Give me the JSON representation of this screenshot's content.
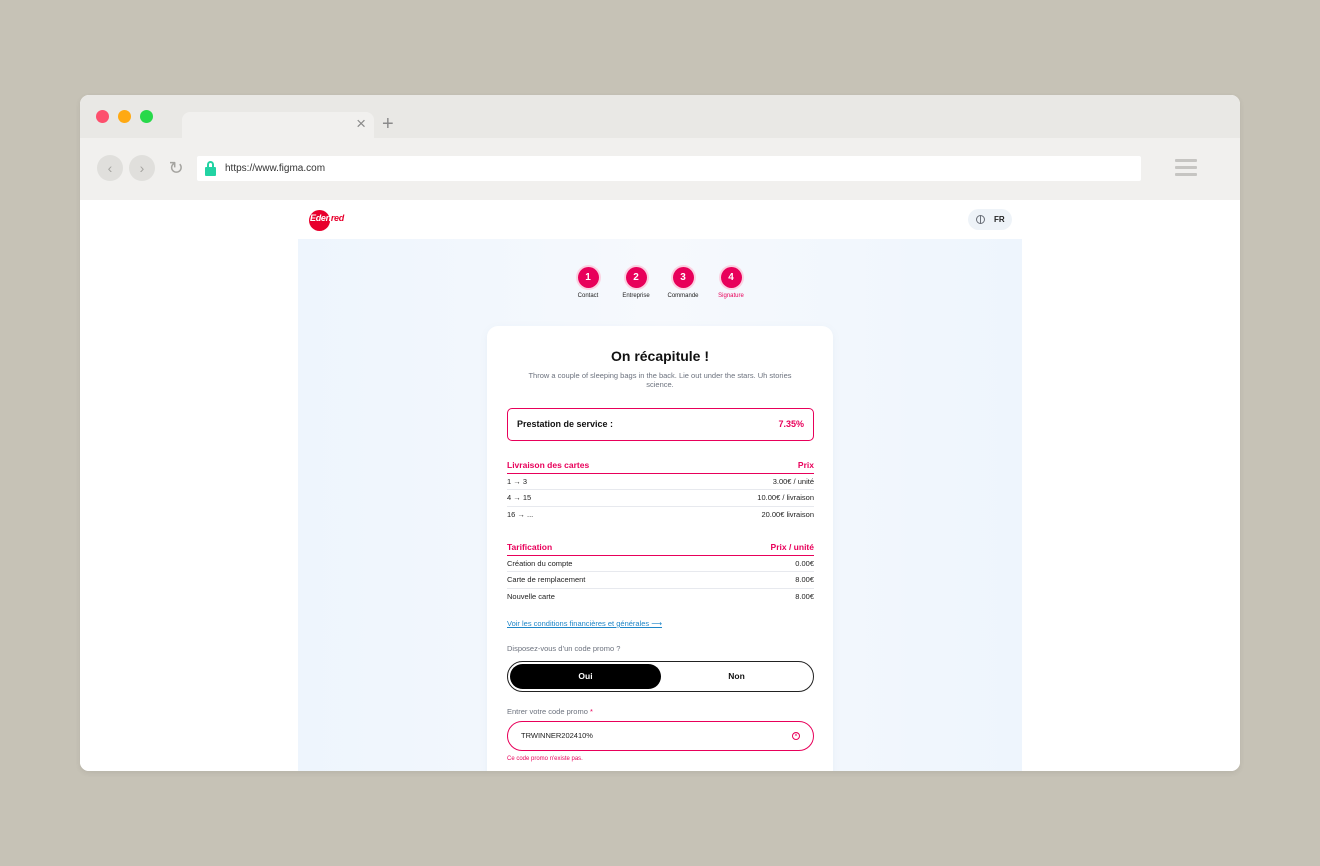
{
  "browser": {
    "url": "https://www.figma.com",
    "tab_close": "×",
    "tab_new": "+",
    "nav_back": "‹",
    "nav_forward": "›",
    "nav_reload": "↻"
  },
  "header": {
    "logo_text_a": "Eden",
    "logo_text_b": "red",
    "language": "FR"
  },
  "steps": [
    {
      "num": "1",
      "label": "Contact"
    },
    {
      "num": "2",
      "label": "Entreprise"
    },
    {
      "num": "3",
      "label": "Commande"
    },
    {
      "num": "4",
      "label": "Signature"
    }
  ],
  "card": {
    "title": "On récapitule !",
    "subtitle": "Throw a couple of sleeping bags in the back. Lie out under the stars. Uh stories science."
  },
  "prestation": {
    "label": "Prestation de service :",
    "value": "7.35%"
  },
  "livraison": {
    "header_left": "Livraison des cartes",
    "header_right": "Prix",
    "rows": [
      {
        "range": "1 → 3",
        "price": "3.00€ / unité"
      },
      {
        "range": "4 → 15",
        "price": "10.00€ / livraison"
      },
      {
        "range": "16 → ...",
        "price": "20.00€ livraison"
      }
    ]
  },
  "tarification": {
    "header_left": "Tarification",
    "header_right": "Prix / unité",
    "rows": [
      {
        "item": "Création du compte",
        "price": "0.00€"
      },
      {
        "item": "Carte de remplacement",
        "price": "8.00€"
      },
      {
        "item": "Nouvelle carte",
        "price": "8.00€"
      }
    ]
  },
  "conditions_link": "Voir les conditions financières et générales ⟶",
  "promo": {
    "question": "Disposez-vous d’un code promo ?",
    "yes": "Oui",
    "no": "Non",
    "selected": "Oui",
    "label": "Entrer votre code promo",
    "required_mark": "*",
    "value": "TRWINNER202410%",
    "error": "Ce code promo n'existe pas."
  },
  "colors": {
    "accent": "#e8005a",
    "brand_red": "#e8002d",
    "link": "#1e86c8"
  }
}
